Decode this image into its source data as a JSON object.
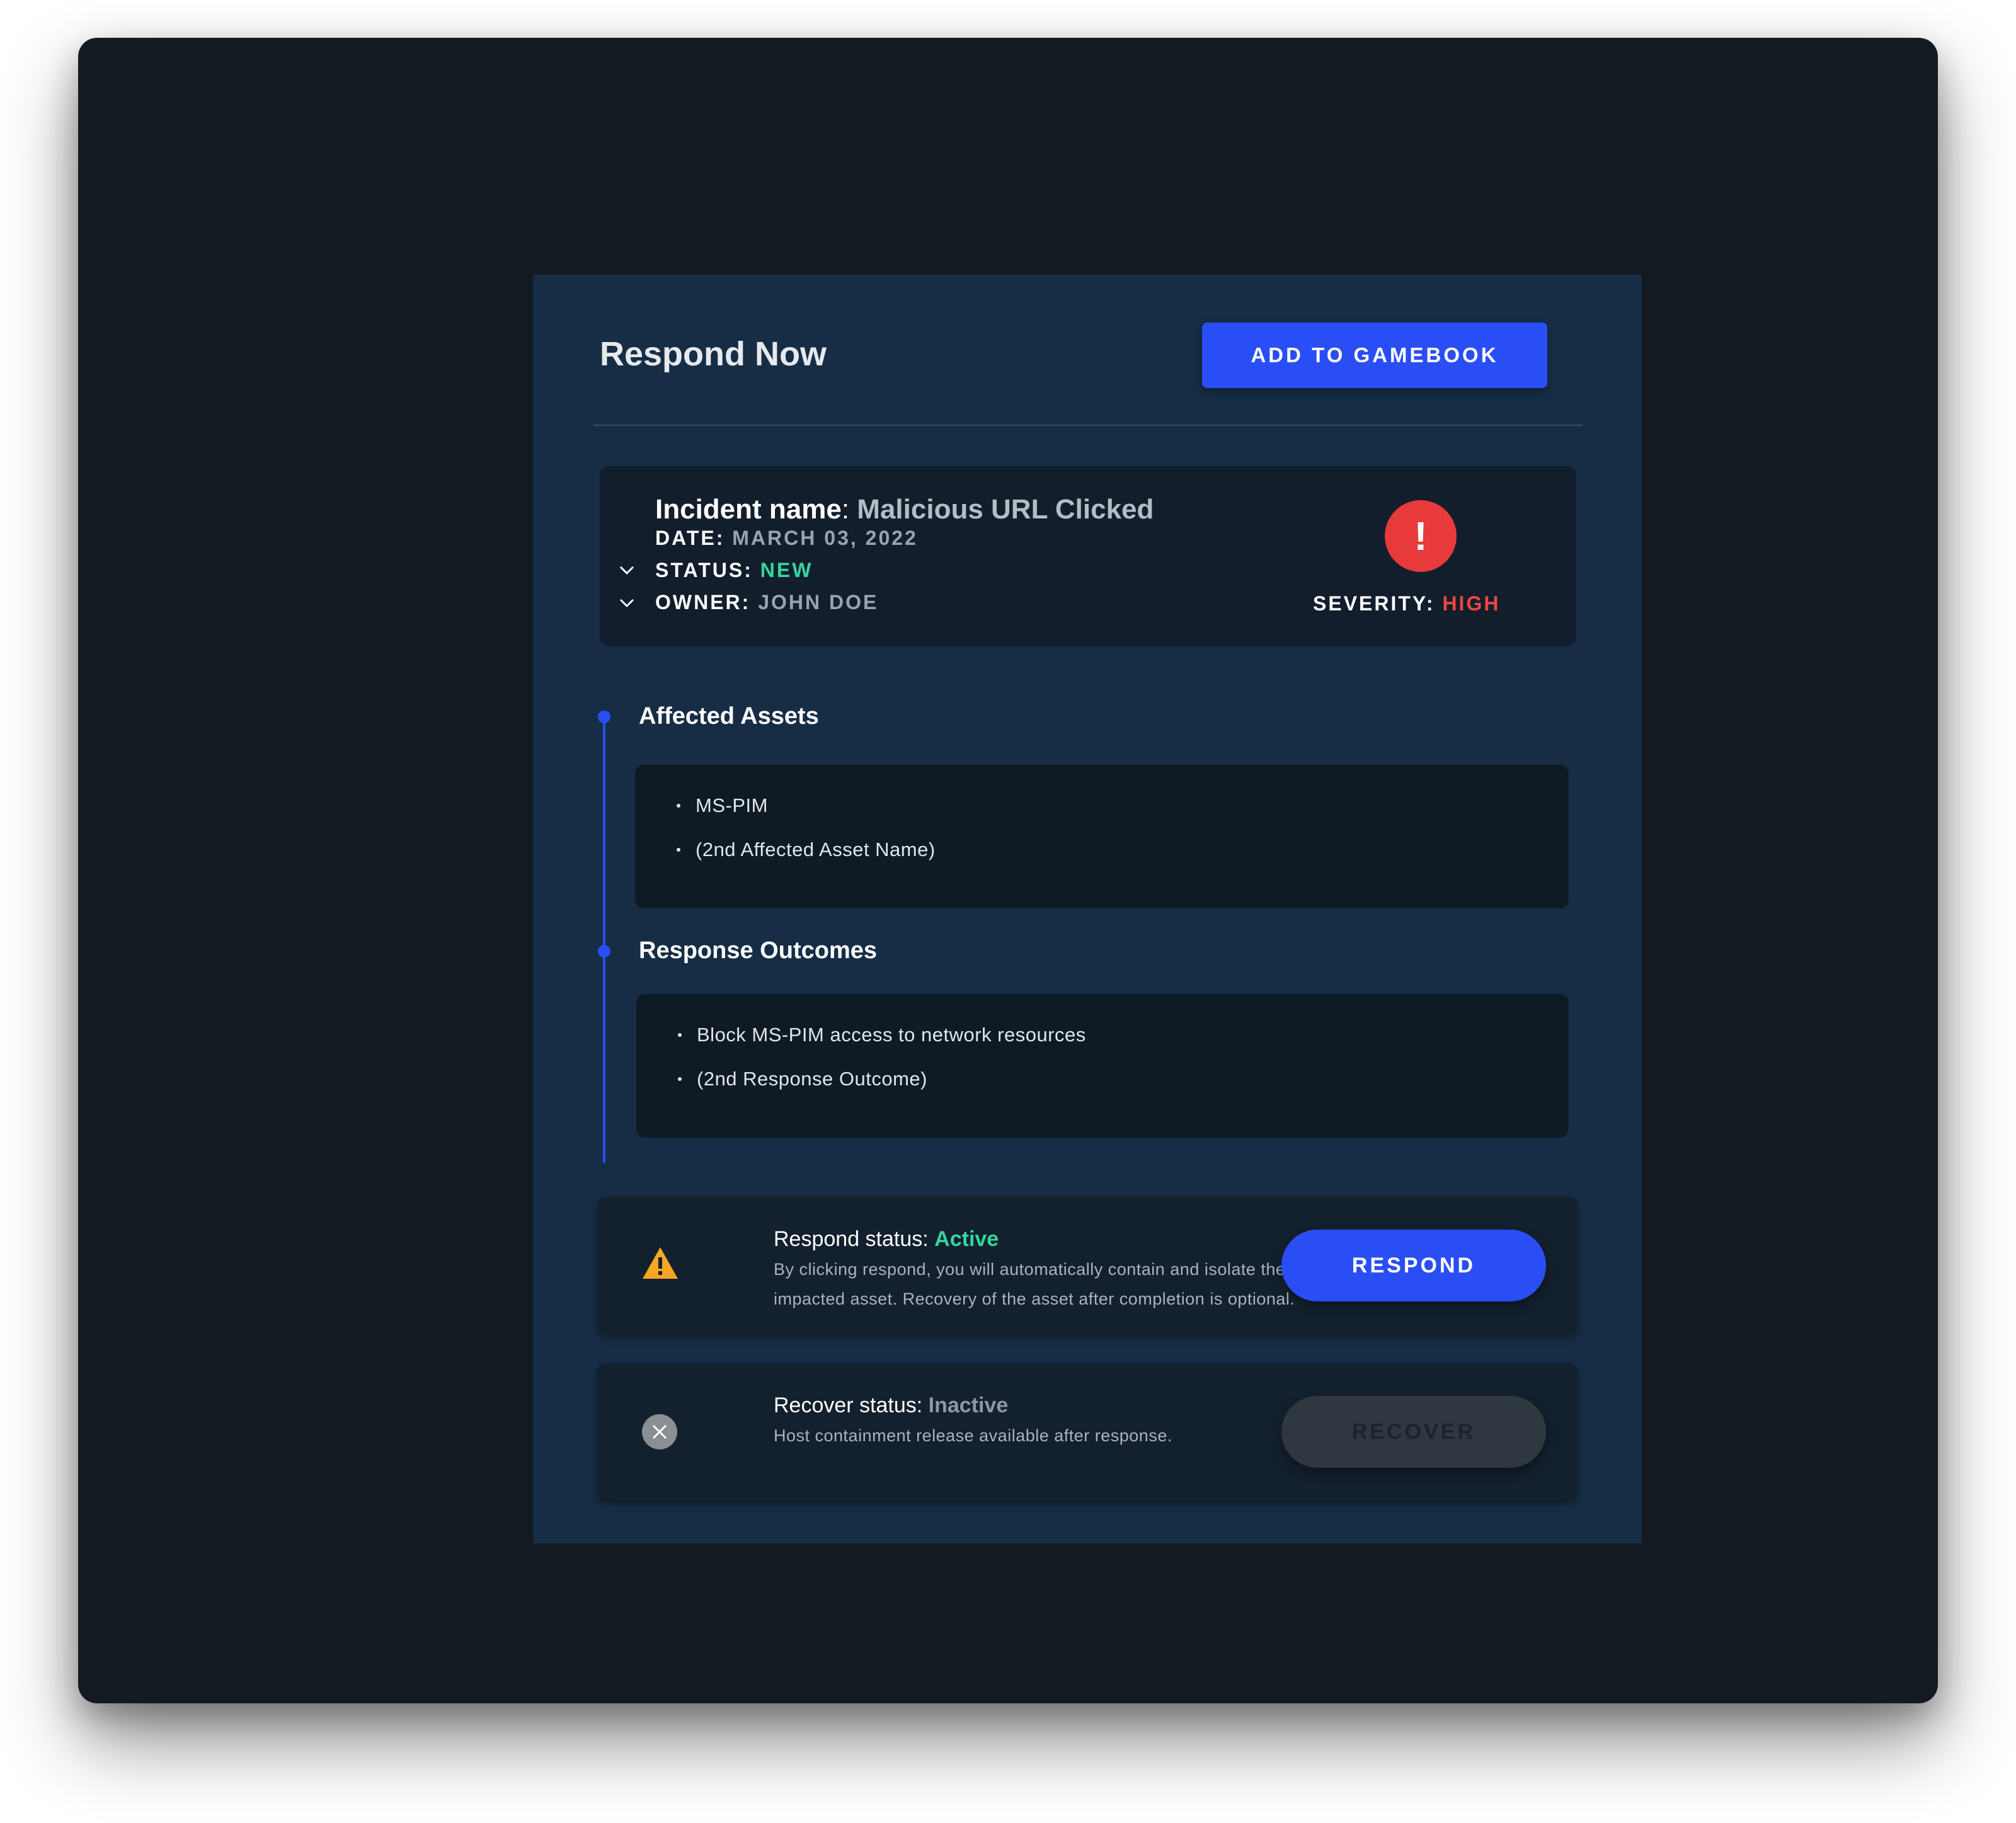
{
  "panel": {
    "title": "Respond Now",
    "add_button_label": "ADD TO GAMEBOOK"
  },
  "incident": {
    "name_label": "Incident name",
    "name_value": "Malicious URL Clicked",
    "date_label": "DATE:",
    "date_value": "MARCH 03, 2022",
    "status_label": "STATUS:",
    "status_value": "NEW",
    "owner_label": "OWNER:",
    "owner_value": "JOHN DOE",
    "severity_icon": "!",
    "severity_label": "SEVERITY:",
    "severity_value": "HIGH"
  },
  "affected_assets": {
    "title": "Affected Assets",
    "items": [
      "MS-PIM",
      "(2nd Affected Asset Name)"
    ]
  },
  "response_outcomes": {
    "title": "Response Outcomes",
    "items": [
      "Block MS-PIM access to network resources",
      "(2nd Response Outcome)"
    ]
  },
  "respond": {
    "status_label": "Respond status:",
    "status_value": "Active",
    "description": "By clicking respond, you will automatically contain and isolate the impacted asset. Recovery of the asset after completion is optional.",
    "button_label": "RESPOND"
  },
  "recover": {
    "status_label": "Recover status:",
    "status_value": "Inactive",
    "description": "Host containment release available after response.",
    "button_label": "RECOVER"
  },
  "colors": {
    "accent": "#2a4ef5",
    "status_new": "#33d69f",
    "severity_high": "#f04545",
    "warning": "#f5a623"
  }
}
